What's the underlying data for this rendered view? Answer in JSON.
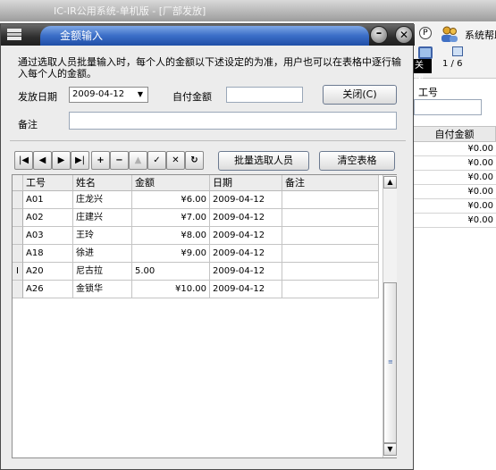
{
  "background_app": {
    "title": "IC-IR公用系统-单机版 - [厂部发放]",
    "toolbar": {
      "p_icon_label": "P",
      "help_label": "系统帮助",
      "close_label": "关闭",
      "page_indicator": "1 / 6"
    },
    "id_label": "工号",
    "grid_header": "自付金额",
    "grid_values": [
      "¥0.00",
      "¥0.00",
      "¥0.00",
      "¥0.00",
      "¥0.00",
      "¥0.00"
    ]
  },
  "dialog": {
    "title": "金额输入",
    "minimize_glyph": "–",
    "close_glyph": "✕",
    "instruction": "通过选取人员批量输入时，每个人的金额以下述设定的为准，用户也可以在表格中逐行输入每个人的金额。",
    "date_label": "发放日期",
    "date_value": "2009-04-12",
    "amount_label": "自付金额",
    "amount_value": "",
    "close_button": "关闭(C)",
    "remark_label": "备注",
    "remark_value": "",
    "nav_buttons": [
      {
        "name": "first-record-button",
        "glyph": "|◀"
      },
      {
        "name": "prior-record-button",
        "glyph": "◀"
      },
      {
        "name": "next-record-button",
        "glyph": "▶"
      },
      {
        "name": "last-record-button",
        "glyph": "▶|"
      },
      {
        "name": "insert-record-button",
        "glyph": "+"
      },
      {
        "name": "delete-record-button",
        "glyph": "−"
      },
      {
        "name": "edit-record-button",
        "glyph": "▲"
      },
      {
        "name": "post-record-button",
        "glyph": "✓"
      },
      {
        "name": "cancel-record-button",
        "glyph": "✕"
      },
      {
        "name": "refresh-button",
        "glyph": "↻"
      }
    ],
    "batch_button": "批量选取人员",
    "clear_button": "清空表格",
    "grid": {
      "columns": [
        "工号",
        "姓名",
        "金额",
        "日期",
        "备注"
      ],
      "current_row_marker": "I",
      "rows": [
        {
          "id": "A01",
          "name": "庄龙兴",
          "amount": "¥6.00",
          "date": "2009-04-12",
          "remark": ""
        },
        {
          "id": "A02",
          "name": "庄建兴",
          "amount": "¥7.00",
          "date": "2009-04-12",
          "remark": ""
        },
        {
          "id": "A03",
          "name": "王玲",
          "amount": "¥8.00",
          "date": "2009-04-12",
          "remark": ""
        },
        {
          "id": "A18",
          "name": "徐进",
          "amount": "¥9.00",
          "date": "2009-04-12",
          "remark": ""
        },
        {
          "id": "A20",
          "name": "尼古拉",
          "amount": "5.00",
          "date": "2009-04-12",
          "remark": ""
        },
        {
          "id": "A26",
          "name": "金锁华",
          "amount": "¥10.00",
          "date": "2009-04-12",
          "remark": ""
        }
      ]
    }
  }
}
